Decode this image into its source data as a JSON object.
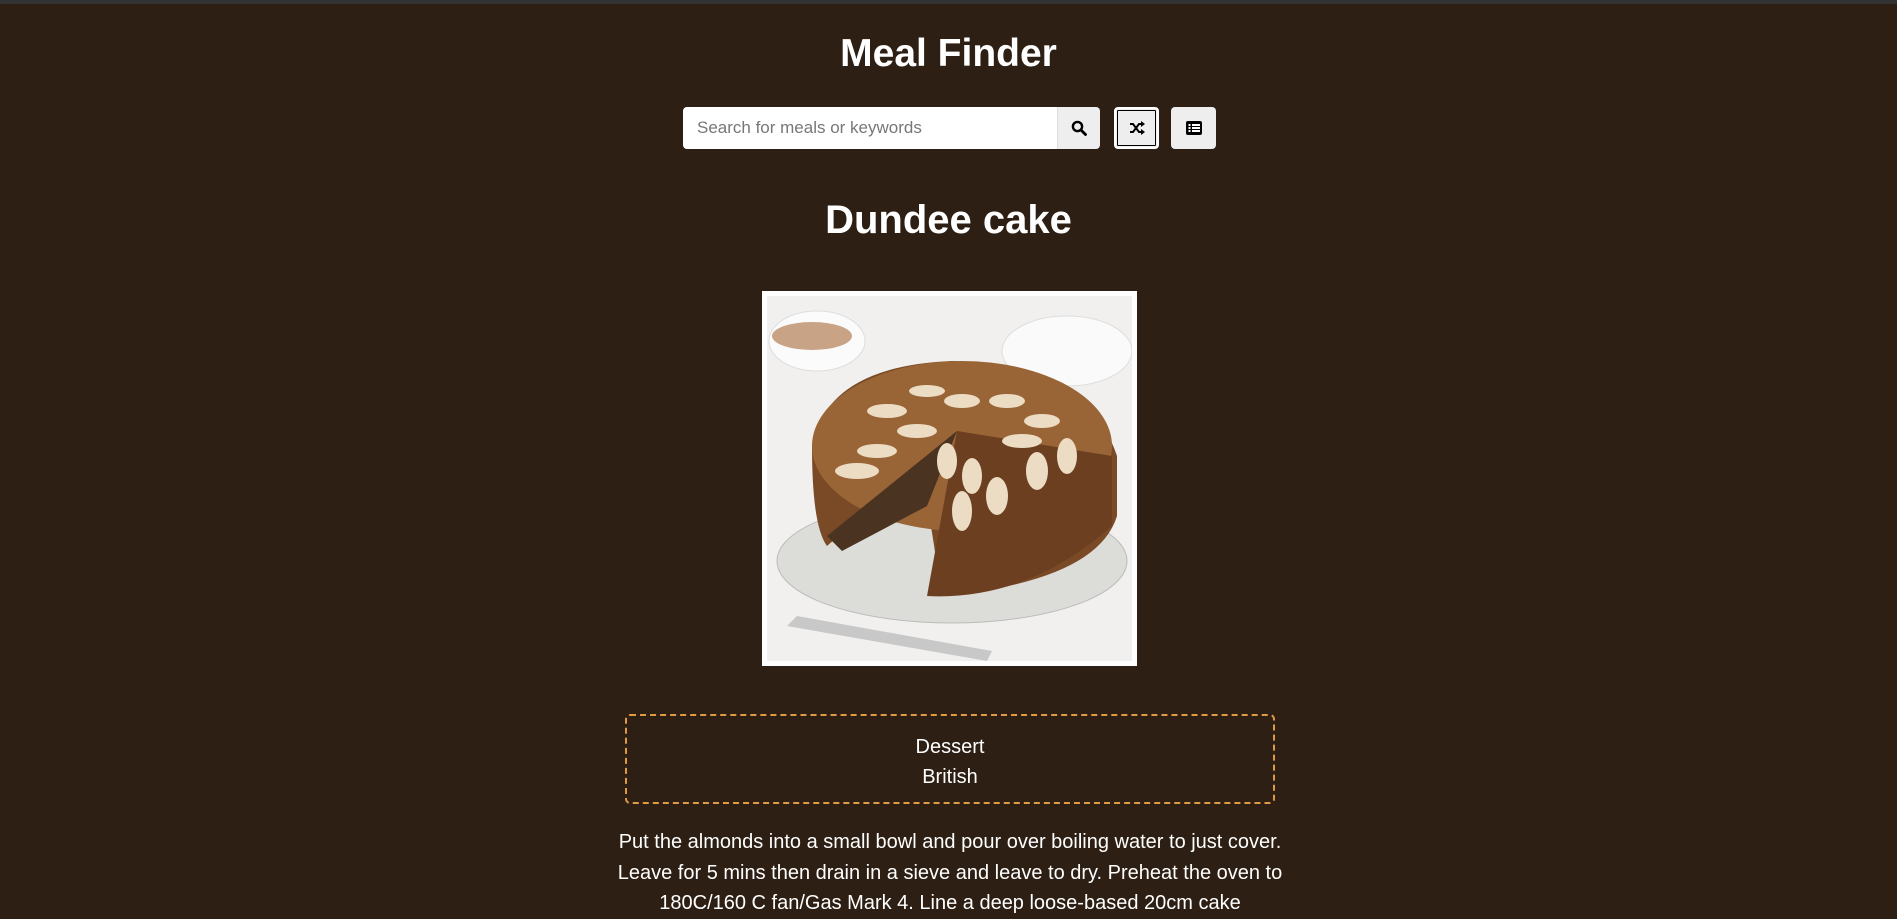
{
  "header": {
    "title": "Meal Finder"
  },
  "search": {
    "placeholder": "Search for meals or keywords",
    "value": ""
  },
  "icons": {
    "search": "search-icon",
    "random": "shuffle-icon",
    "list": "list-icon"
  },
  "meal": {
    "title": "Dundee cake",
    "category": "Dessert",
    "area": "British",
    "instructions": "Put the almonds into a small bowl and pour over boiling water to just cover. Leave for 5 mins then drain in a sieve and leave to dry. Preheat the oven to 180C/160 C fan/Gas Mark 4. Line a deep loose-based 20cm cake"
  },
  "colors": {
    "background": "#2d1f13",
    "accent_border": "#e09a44"
  }
}
